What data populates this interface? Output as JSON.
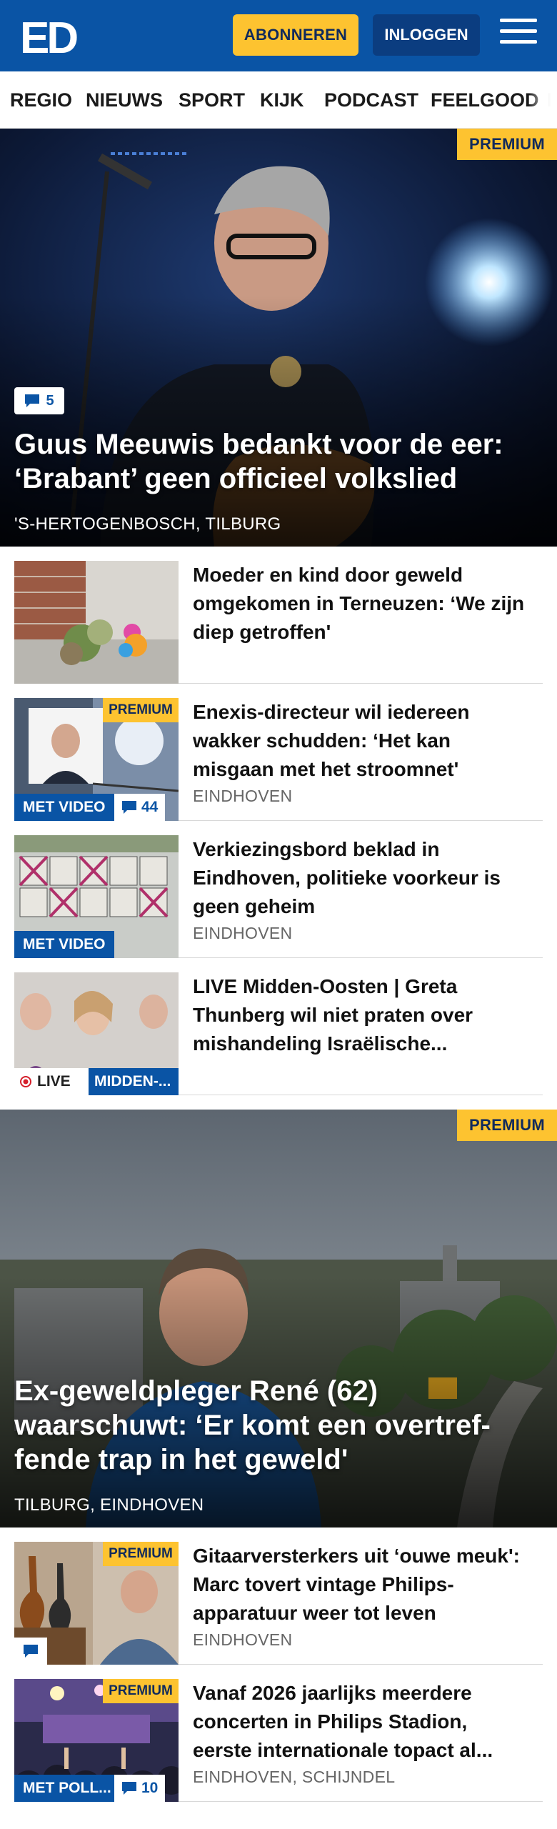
{
  "header": {
    "logo_text": "ED",
    "subscribe_label": "ABONNEREN",
    "login_label": "INLOGGEN",
    "menu_icon": "hamburger-icon",
    "brand_color": "#0a54a5",
    "accent_color": "#fdc330"
  },
  "nav": {
    "items": [
      "REGIO",
      "NIEUWS",
      "SPORT",
      "KIJK",
      "PODCAST",
      "FEELGOOD",
      "I"
    ]
  },
  "hero1": {
    "badge": "PREMIUM",
    "comment_count": "5",
    "title": "Guus Meeuwis bedankt voor de eer: ‘Brabant’ geen officieel volkslied",
    "location": "'S-HERTOGENBOSCH, TILBURG"
  },
  "articles": [
    {
      "title": "Moeder en kind door geweld omgekomen in Terneuzen: ‘We zijn diep getroffen'",
      "location": ""
    },
    {
      "title": "Enexis-directeur wil iedereen wakker schudden: ‘Het kan misgaan met het stroomnet'",
      "location": "EINDHOVEN",
      "badge": "PREMIUM",
      "video_tag": "MET VIDEO",
      "comment_count": "44"
    },
    {
      "title": "Verkiezingsbord beklad in Eindhoven, politieke voorkeur is geen geheim",
      "location": "EINDHOVEN",
      "video_tag": "MET VIDEO"
    },
    {
      "title": "LIVE Midden-Oosten | Greta Thunberg wil niet praten over mishandeling Israëlische...",
      "location": "",
      "live_tag": "LIVE",
      "topic_tag": "MIDDEN-..."
    }
  ],
  "hero2": {
    "badge": "PREMIUM",
    "title": "Ex-geweldpleger René (62) waarschuwt: ‘Er komt een overtref­fende trap in het geweld'",
    "location": "TILBURG, EINDHOVEN"
  },
  "articles2": [
    {
      "title": "Gitaarversterkers uit ‘ouwe meuk': Marc tovert vintage Phi­lips-apparatuur weer tot leven",
      "location": "EINDHOVEN",
      "badge": "PREMIUM"
    },
    {
      "title": "Vanaf 2026 jaarlijks meerdere concerten in Philips Stadion, eerste internationale topact al...",
      "location": "EINDHOVEN, SCHIJNDEL",
      "badge": "PREMIUM",
      "poll_tag": "MET POLL...",
      "comment_count": "10"
    }
  ]
}
